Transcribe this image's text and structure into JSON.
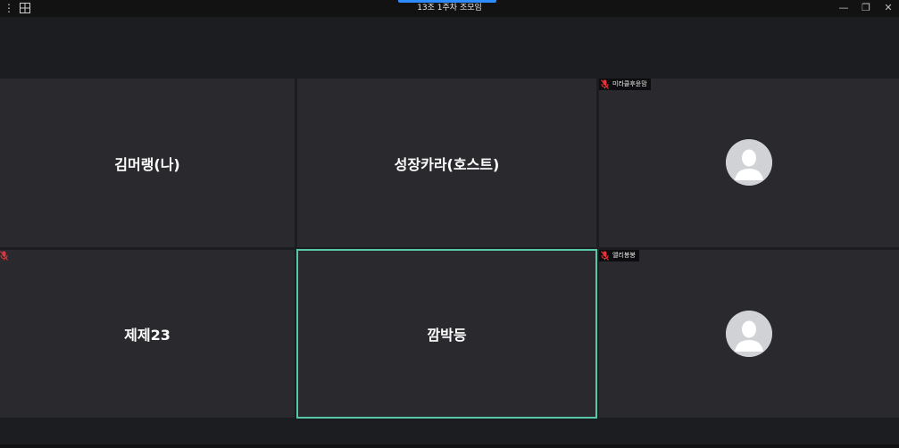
{
  "window": {
    "title": "13조 1주차 조모임",
    "icons": [
      "more-vertical-icon",
      "gallery-view-icon",
      "minimize-icon",
      "restore-icon",
      "close-icon"
    ],
    "minimize_glyph": "—",
    "restore_glyph": "❐",
    "close_glyph": "✕",
    "more_glyph": "⋮"
  },
  "colors": {
    "background": "#1c1d20",
    "tile": "#2a2a2e",
    "active_speaker_border": "#57c8a7",
    "muted_mic": "#e0343a",
    "title_accent": "#2d8cff"
  },
  "participants": [
    {
      "name": "김머랭(나)",
      "display": "name",
      "muted": false
    },
    {
      "name": "성장카라(호스트)",
      "display": "name",
      "muted": false
    },
    {
      "name": "미라클후윤맘",
      "display": "avatar",
      "muted": true
    },
    {
      "name": "제제23",
      "display": "name",
      "muted": true
    },
    {
      "name": "깜박등",
      "display": "name",
      "muted": false,
      "active_speaker": true
    },
    {
      "name": "앨리봉봉",
      "display": "avatar",
      "muted": true
    }
  ]
}
